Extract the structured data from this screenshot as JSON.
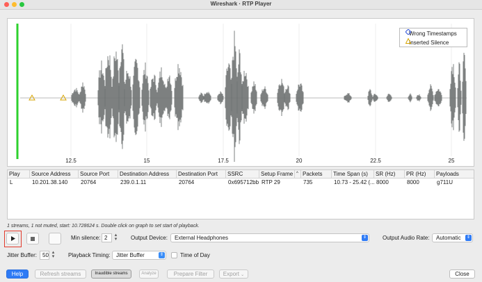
{
  "window": {
    "title": "Wireshark · RTP Player"
  },
  "graph": {
    "legend": {
      "wrong_timestamps": "Wrong Timestamps",
      "inserted_silence": "Inserted Silence"
    },
    "x_ticks": [
      "12.5",
      "15",
      "17.5",
      "20",
      "22.5",
      "25"
    ]
  },
  "table": {
    "headers": [
      "Play",
      "Source Address",
      "Source Port",
      "Destination Address",
      "Destination Port",
      "SSRC",
      "Setup Frame",
      "Packets",
      "Time Span (s)",
      "SR (Hz)",
      "PR (Hz)",
      "Payloads"
    ],
    "sort_indicator": "^",
    "rows": [
      [
        "L",
        "10.201.38.140",
        "20764",
        "239.0.1.11",
        "20764",
        "0x695712bb",
        "RTP 29",
        "735",
        "10.73 - 25.42 (...",
        "8000",
        "8000",
        "g711U"
      ]
    ]
  },
  "status_text": "1 streams, 1 not muted, start: 10.728624 s. Double click on graph to set start of playback.",
  "controls": {
    "min_silence_label": "Min silence:",
    "min_silence_value": "2",
    "output_device_label": "Output Device:",
    "output_device_value": "External Headphones",
    "output_audio_rate_label": "Output Audio Rate:",
    "output_audio_rate_value": "Automatic",
    "jitter_buffer_label": "Jitter Buffer:",
    "jitter_buffer_value": "50",
    "playback_timing_label": "Playback Timing:",
    "playback_timing_value": "Jitter Buffer",
    "time_of_day_label": "Time of Day"
  },
  "buttons": {
    "help": "Help",
    "refresh_streams": "Refresh streams",
    "inaudible_streams": "Inaudible streams",
    "analyze": "Analyze",
    "prepare_filter": "Prepare Filter",
    "export": "Export",
    "close": "Close"
  },
  "colors": {
    "playhead": "#2ed12e",
    "waveform": "#6f7373",
    "accent_blue": "#2f7bf5",
    "highlight_red": "#e23a2c",
    "wrong_timestamps_marker": "#2a4fd6",
    "silence_marker": "#d7a400"
  }
}
